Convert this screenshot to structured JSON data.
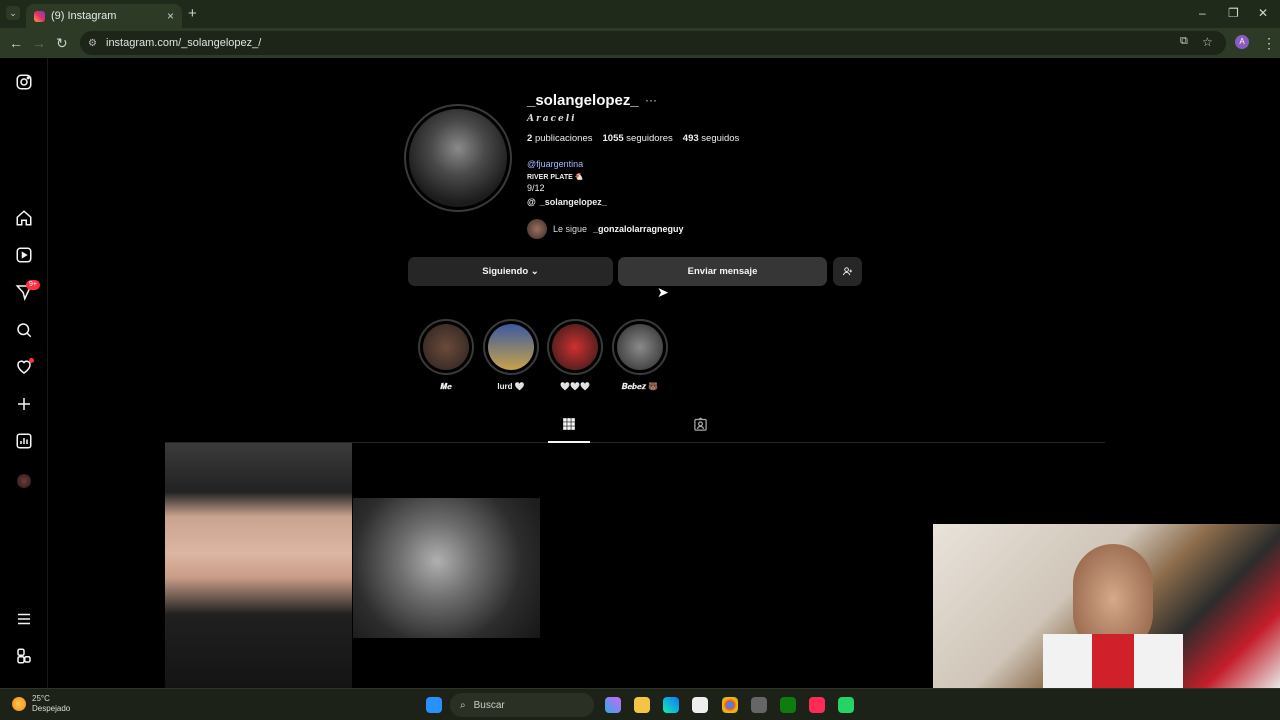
{
  "browser": {
    "tab_title": "(9) Instagram",
    "tab_close": "×",
    "new_tab": "+",
    "tab_menu": "⌄",
    "url": "instagram.com/_solangelopez_/",
    "profile_initial": "A",
    "win_min": "–",
    "win_max": "❐",
    "win_close": "✕",
    "back": "←",
    "forward": "→",
    "reload": "↻",
    "menu": "⋮"
  },
  "sidebar": {
    "notif_badge": "9+",
    "icons": [
      "instagram-icon",
      "home-icon",
      "reels-icon",
      "messages-icon",
      "search-icon",
      "heart-icon",
      "create-icon",
      "dashboard-icon",
      "profile-avatar",
      "menu-icon",
      "threads-app-icon"
    ]
  },
  "profile": {
    "username": "_solangelopez_",
    "more": "···",
    "fullname": "Araceli",
    "posts_count": "2",
    "posts_label": "publicaciones",
    "followers_count": "1055",
    "followers_label": "seguidores",
    "following_count": "493",
    "following_label": "seguidos",
    "bio_link": "@fjuargentina",
    "bio_line1": "RIVER PLATE 🐔",
    "bio_line2": "9/12",
    "threads_handle": "_solangelopez_",
    "followed_by_prefix": "Le sigue",
    "followed_by_user": "_gonzalolarragneguy"
  },
  "actions": {
    "following_button": "Siguiendo ⌄",
    "message_button": "Enviar mensaje",
    "add_user_icon": "add-user-icon"
  },
  "highlights": [
    {
      "label": "𝑴𝒆",
      "colors": [
        "#6b4a3a",
        "#2a2220"
      ]
    },
    {
      "label": "lurd 🤍",
      "colors": [
        "#3a5aa0",
        "#c9a24a"
      ]
    },
    {
      "label": "🤍🤍🤍",
      "colors": [
        "#d03030",
        "#2a1a1a"
      ]
    },
    {
      "label": "𝑩𝒆𝒃𝒆𝒛 🐻",
      "colors": [
        "#8a8a8a",
        "#2a2a2a"
      ]
    }
  ],
  "tabs": {
    "posts_icon": "grid-icon",
    "tagged_icon": "tagged-icon"
  },
  "taskbar": {
    "temperature": "25°C",
    "weather_desc": "Despejado",
    "search_placeholder": "Buscar"
  },
  "colors": {
    "accent_link": "#a7b8ff",
    "badge_red": "#ff3040",
    "button_bg": "#262626"
  }
}
